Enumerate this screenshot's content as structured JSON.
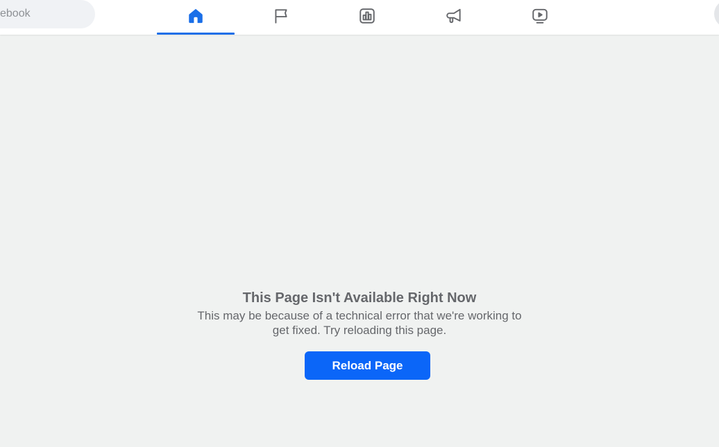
{
  "header": {
    "search": {
      "visible_text": "ebook",
      "placeholder": "Search Facebook"
    },
    "nav_tabs": [
      {
        "name": "home",
        "icon": "home-icon",
        "active": true
      },
      {
        "name": "pages",
        "icon": "flag-icon",
        "active": false
      },
      {
        "name": "insights",
        "icon": "bar-chart-icon",
        "active": false
      },
      {
        "name": "ads",
        "icon": "megaphone-icon",
        "active": false
      },
      {
        "name": "watch",
        "icon": "video-icon",
        "active": false
      }
    ]
  },
  "colors": {
    "accent": "#1a6fe8",
    "button": "#0b66f8",
    "background": "#f0f2f1",
    "text_muted": "#65676b",
    "icon_inactive": "#65676b"
  },
  "error": {
    "title": "This Page Isn't Available Right Now",
    "message": "This may be because of a technical error that we're working to get fixed. Try reloading this page.",
    "button_label": "Reload Page"
  }
}
